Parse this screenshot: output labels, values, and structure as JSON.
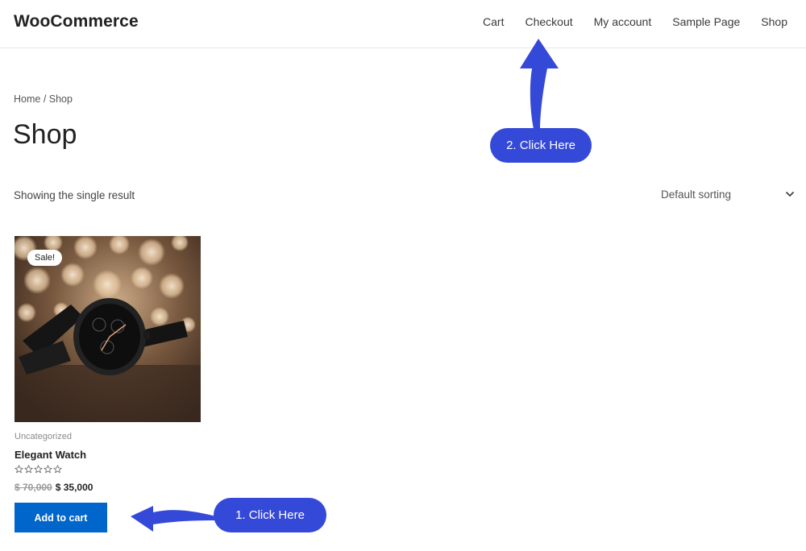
{
  "header": {
    "site_title": "WooCommerce",
    "nav": [
      "Cart",
      "Checkout",
      "My account",
      "Sample Page",
      "Shop"
    ]
  },
  "breadcrumb": "Home / Shop",
  "page_title": "Shop",
  "result_count": "Showing the single result",
  "sorting": {
    "selected": "Default sorting",
    "icon": "chevron-down-icon"
  },
  "product": {
    "badge": "Sale!",
    "category": "Uncategorized",
    "name": "Elegant Watch",
    "rating": 0,
    "rating_max": 5,
    "price_old": "$ 70,000",
    "price_new": "$ 35,000",
    "button": "Add to cart"
  },
  "annotations": {
    "callout_1": "1. Click Here",
    "callout_2": "2. Click Here",
    "arrow_color": "#3549d8"
  },
  "colors": {
    "primary_button": "#0066cc",
    "callout_bg": "#3549d8"
  }
}
